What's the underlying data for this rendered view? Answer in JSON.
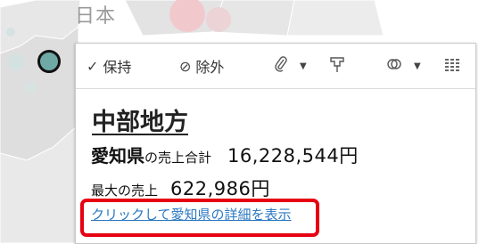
{
  "map": {
    "label": "日本"
  },
  "toolbar": {
    "keep_label": "保持",
    "exclude_label": "除外",
    "icons": {
      "keep": "check-icon",
      "exclude": "exclude-circle-icon",
      "group": "paperclip-icon",
      "pin": "pin-icon",
      "sets": "sets-icon",
      "view": "view-data-icon"
    }
  },
  "tooltip": {
    "title": "中部地方",
    "prefecture": "愛知県",
    "sales_total_label": "の売上合計",
    "sales_total_value": "16,228,544円",
    "max_sales_label": "最大の売上",
    "max_sales_value": "622,986円",
    "link_text": "クリックして愛知県の詳細を表示"
  },
  "colors": {
    "marker": "#6ea9a6",
    "highlight_box": "#e60012",
    "link": "#2b78c2"
  }
}
